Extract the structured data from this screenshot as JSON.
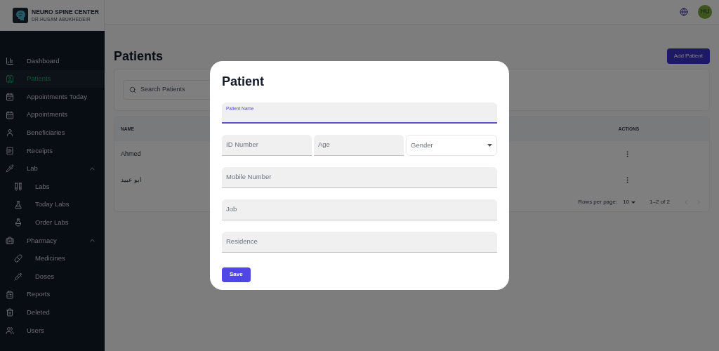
{
  "brand": {
    "title": "NEURO SPINE CENTER",
    "subtitle": "DR.HUSAM ABUKHEDEIR"
  },
  "header": {
    "avatar": "HU"
  },
  "sidebar": {
    "items": [
      {
        "label": "Dashboard",
        "selected": false
      },
      {
        "label": "Patients",
        "selected": true
      },
      {
        "label": "Appointments Today",
        "selected": false
      },
      {
        "label": "Appointments",
        "selected": false
      },
      {
        "label": "Beneficiaries",
        "selected": false
      },
      {
        "label": "Receipts",
        "selected": false
      },
      {
        "label": "Lab",
        "selected": false,
        "expanded": true,
        "children": [
          {
            "label": "Labs",
            "selected": false
          },
          {
            "label": "Today Labs",
            "selected": false
          },
          {
            "label": "Order Labs",
            "selected": false
          }
        ]
      },
      {
        "label": "Pharmacy",
        "selected": false,
        "expanded": true,
        "children": [
          {
            "label": "Medicines",
            "selected": false
          },
          {
            "label": "Doses",
            "selected": false
          }
        ]
      },
      {
        "label": "Reports",
        "selected": false
      },
      {
        "label": "Deleted",
        "selected": false
      },
      {
        "label": "Users",
        "selected": false
      }
    ]
  },
  "page": {
    "title": "Patients",
    "add_button": "Add Patient",
    "search": {
      "placeholder": "Search Patients"
    }
  },
  "table": {
    "columns": [
      "NAME",
      "ACTIONS"
    ],
    "rows": [
      {
        "name": "Ahmed"
      },
      {
        "name": "ابو عبيد"
      }
    ],
    "pagination": {
      "rows_per_page_label": "Rows per page:",
      "rows_per_page": "10",
      "range": "1–2 of 2",
      "prev_disabled": true,
      "next_disabled": true
    }
  },
  "dialog": {
    "title": "Patient",
    "fields": [
      {
        "kind": "text",
        "label": "Patient Name",
        "focused": true
      },
      {
        "kind": "text",
        "label": "ID Number",
        "focused": false
      },
      {
        "kind": "text",
        "label": "Age",
        "focused": false
      },
      {
        "kind": "select",
        "label": "Gender",
        "focused": false
      },
      {
        "kind": "text",
        "label": "Mobile Number",
        "focused": false
      },
      {
        "kind": "text",
        "label": "Job",
        "focused": false
      },
      {
        "kind": "text",
        "label": "Residence",
        "focused": false
      }
    ],
    "save_button": "Save"
  }
}
